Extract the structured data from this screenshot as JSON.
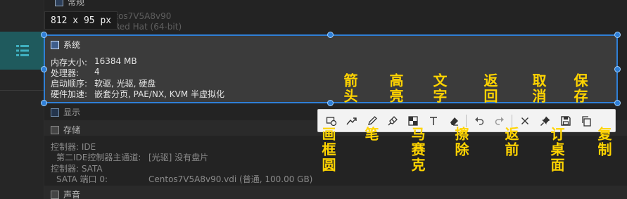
{
  "top_partial": {
    "section": "常规",
    "name_value": "Centos7V5A8v90",
    "os_value": "Red Hat (64-bit)"
  },
  "size_indicator": "812 x 95 px",
  "system": {
    "title": "系统",
    "rows": [
      {
        "label": "内存大小:",
        "value": "16384 MB"
      },
      {
        "label": "处理器:",
        "value": "4"
      },
      {
        "label": "启动顺序:",
        "value": "软驱, 光驱, 硬盘"
      },
      {
        "label": "硬件加速:",
        "value": "嵌套分页, PAE/NX, KVM 半虚拟化"
      }
    ]
  },
  "display": {
    "title": "显示"
  },
  "storage": {
    "title": "存储",
    "rows": [
      {
        "label": "控制器: IDE",
        "value": ""
      },
      {
        "label": "第二IDE控制器主通道:",
        "value": "[光驱] 没有盘片"
      },
      {
        "label": "控制器: SATA",
        "value": ""
      },
      {
        "label": "SATA 端口 0:",
        "value": "Centos7V5A8v90.vdi (普通, 100.00 GB)"
      }
    ]
  },
  "audio": {
    "title": "声音"
  },
  "toolbar": {
    "tools": [
      {
        "name": "rect-circle-tool",
        "icon": "rect-circle-icon"
      },
      {
        "name": "arrow-tool",
        "icon": "arrow-icon"
      },
      {
        "name": "pen-tool",
        "icon": "pen-icon"
      },
      {
        "name": "highlight-tool",
        "icon": "highlighter-icon"
      },
      {
        "name": "mosaic-tool",
        "icon": "mosaic-icon"
      },
      {
        "name": "text-tool",
        "icon": "text-icon"
      },
      {
        "name": "eraser-tool",
        "icon": "eraser-icon"
      },
      {
        "name": "undo-tool",
        "icon": "undo-icon"
      },
      {
        "name": "redo-tool",
        "icon": "redo-icon"
      },
      {
        "name": "cancel-tool",
        "icon": "close-icon"
      },
      {
        "name": "pin-tool",
        "icon": "pin-icon"
      },
      {
        "name": "save-tool",
        "icon": "save-icon"
      },
      {
        "name": "copy-tool",
        "icon": "copy-icon"
      }
    ]
  },
  "annotations": {
    "arrow": "箭头",
    "highlight": "高亮",
    "text": "文字",
    "undo": "返回",
    "cancel": "取消",
    "save": "保存",
    "rect_circle": "画框圆",
    "pen": "笔",
    "mosaic": "马赛克",
    "eraser": "擦除",
    "redo": "返前",
    "pin": "订桌面",
    "copy": "复制"
  },
  "colors": {
    "selection": "#2f7fd6",
    "annotation": "#ffd400",
    "teal_tile": "#1f5a5d"
  }
}
